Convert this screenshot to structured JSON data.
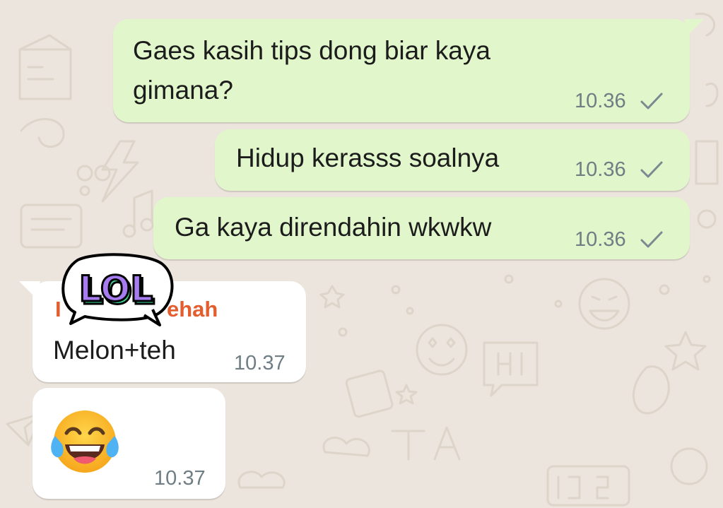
{
  "colors": {
    "wallpaper": "#ece5dd",
    "outgoing_bubble": "#e1f7cb",
    "incoming_bubble": "#ffffff",
    "sender_name": "#e35d2e",
    "timestamp": "#6f7e84",
    "tick": "#7a8a91",
    "sticker_purple": "#a67cf0",
    "sticker_green": "#3fd59a"
  },
  "messages": {
    "m1": {
      "direction": "outgoing",
      "line1": "Gaes kasih tips dong biar kaya",
      "line2": "gimana?",
      "time": "10.36",
      "status": "sent-single-tick"
    },
    "m2": {
      "direction": "outgoing",
      "text": "Hidup kerasss soalnya",
      "time": "10.36",
      "status": "sent-single-tick"
    },
    "m3": {
      "direction": "outgoing",
      "text": "Ga kaya direndahin wkwkw",
      "time": "10.36",
      "status": "sent-single-tick"
    },
    "m4": {
      "direction": "incoming",
      "sender_visible": "ehah",
      "sender_left_fragment": "I",
      "text": "Melon+teh",
      "time": "10.37"
    },
    "m5": {
      "direction": "incoming",
      "emoji": "😂",
      "emoji_name": "face-with-tears-of-joy",
      "time": "10.37"
    }
  },
  "sticker": {
    "text": "LOL",
    "icon": "lol-speech-bubble-sticker"
  }
}
